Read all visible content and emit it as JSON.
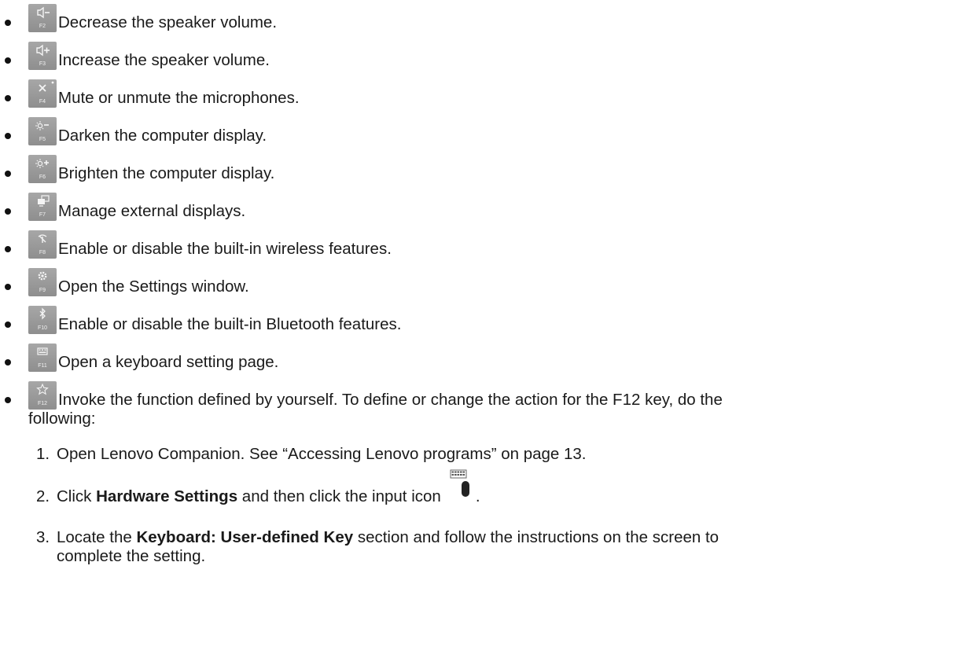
{
  "items": [
    {
      "key_label": "F2",
      "icon": "volume-down-icon",
      "text": "Decrease the speaker volume."
    },
    {
      "key_label": "F3",
      "icon": "volume-up-icon",
      "text": "Increase the speaker volume."
    },
    {
      "key_label": "F4",
      "icon": "microphone-mute-icon",
      "text": "Mute or unmute the microphones."
    },
    {
      "key_label": "F5",
      "icon": "brightness-down-icon",
      "text": "Darken the computer display."
    },
    {
      "key_label": "F6",
      "icon": "brightness-up-icon",
      "text": "Brighten the computer display."
    },
    {
      "key_label": "F7",
      "icon": "external-display-icon",
      "text": "Manage external displays."
    },
    {
      "key_label": "F8",
      "icon": "wireless-icon",
      "text": "Enable or disable the built-in wireless features."
    },
    {
      "key_label": "F9",
      "icon": "settings-gear-icon",
      "text": "Open the Settings window."
    },
    {
      "key_label": "F10",
      "icon": "bluetooth-icon",
      "text": "Enable or disable the built-in Bluetooth features."
    },
    {
      "key_label": "F11",
      "icon": "keyboard-icon",
      "text": "Open a keyboard setting page."
    },
    {
      "key_label": "F12",
      "icon": "star-icon",
      "text": "Invoke the function defined by yourself. To define or change the action for the F12 key, do the",
      "text_cont": "following:"
    }
  ],
  "steps": [
    {
      "num": "1.",
      "text": "Open Lenovo Companion. See “Accessing Lenovo programs” on page 13."
    },
    {
      "num": "2.",
      "pre": "Click ",
      "bold": "Hardware Settings",
      "post": " and then click the input icon",
      "end": ".",
      "icon": "input-icon"
    },
    {
      "num": "3.",
      "pre": "Locate the ",
      "bold": "Keyboard: User-defined Key",
      "post": " section and follow the instructions on the screen to",
      "cont": "complete the setting."
    }
  ]
}
